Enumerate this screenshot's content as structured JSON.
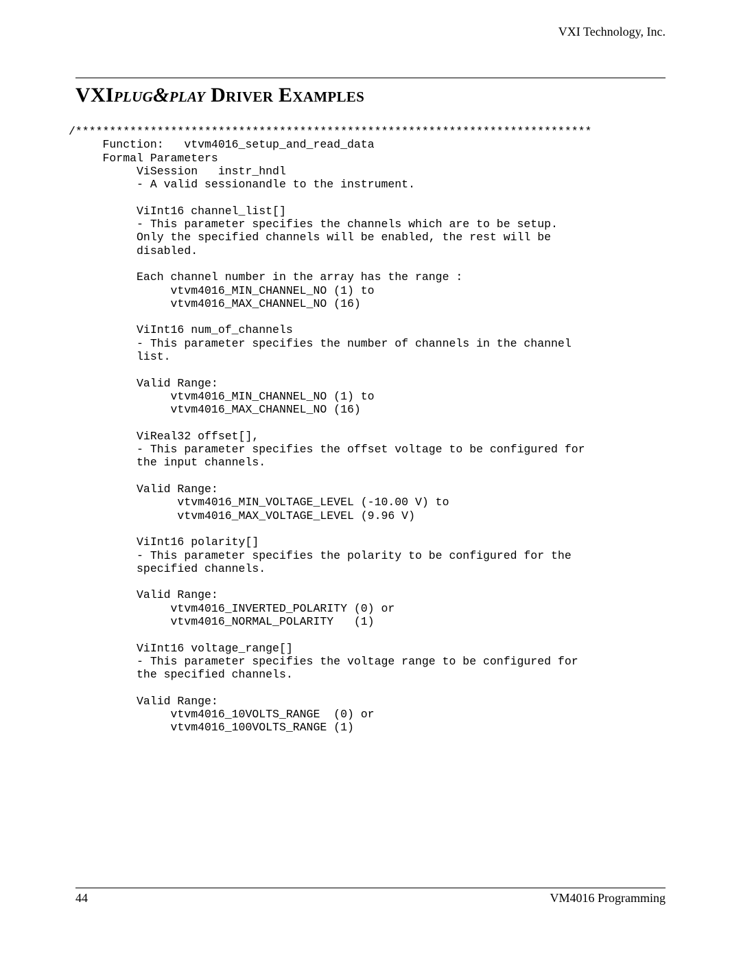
{
  "header": {
    "company": "VXI Technology, Inc."
  },
  "title": {
    "brand_upper": "VXI",
    "brand_ital": "plug&play",
    "rest": " Driver Examples"
  },
  "code": "/****************************************************************************\n     Function:   vtvm4016_setup_and_read_data\n     Formal Parameters\n          ViSession   instr_hndl\n          - A valid sessionandle to the instrument.\n\n          ViInt16 channel_list[]\n          - This parameter specifies the channels which are to be setup.\n          Only the specified channels will be enabled, the rest will be\n          disabled.\n\n          Each channel number in the array has the range :\n               vtvm4016_MIN_CHANNEL_NO (1) to\n               vtvm4016_MAX_CHANNEL_NO (16)\n\n          ViInt16 num_of_channels\n          - This parameter specifies the number of channels in the channel\n          list.\n\n          Valid Range:\n               vtvm4016_MIN_CHANNEL_NO (1) to\n               vtvm4016_MAX_CHANNEL_NO (16)\n\n          ViReal32 offset[],\n          - This parameter specifies the offset voltage to be configured for\n          the input channels.\n\n          Valid Range:\n                vtvm4016_MIN_VOLTAGE_LEVEL (-10.00 V) to\n                vtvm4016_MAX_VOLTAGE_LEVEL (9.96 V)\n\n          ViInt16 polarity[]\n          - This parameter specifies the polarity to be configured for the\n          specified channels.\n\n          Valid Range:\n               vtvm4016_INVERTED_POLARITY (0) or\n               vtvm4016_NORMAL_POLARITY   (1)\n\n          ViInt16 voltage_range[]\n          - This parameter specifies the voltage range to be configured for\n          the specified channels.\n\n          Valid Range:\n               vtvm4016_10VOLTS_RANGE  (0) or\n               vtvm4016_100VOLTS_RANGE (1)",
  "footer": {
    "page_number": "44",
    "section": "VM4016 Programming"
  }
}
